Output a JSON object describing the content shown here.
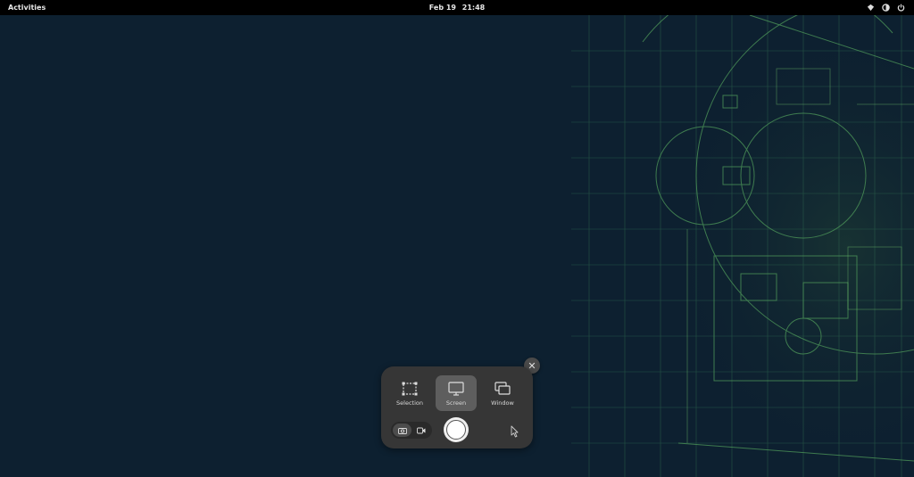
{
  "topbar": {
    "activities": "Activities",
    "date": "Feb 19",
    "time": "21:48",
    "tray_icons": [
      "network-icon",
      "volume-icon",
      "power-icon"
    ]
  },
  "screenshot_panel": {
    "modes": [
      {
        "label": "Selection",
        "icon": "selection-icon",
        "active": false
      },
      {
        "label": "Screen",
        "icon": "screen-icon",
        "active": true
      },
      {
        "label": "Window",
        "icon": "window-icon",
        "active": false
      }
    ],
    "toggle_options": [
      "screenshot-icon",
      "screencast-icon"
    ],
    "close_icon": "close-icon",
    "capture_icon": "capture-icon",
    "pointer_icon": "pointer-icon"
  },
  "colors": {
    "background": "#0d2030",
    "panel": "#363636",
    "active_mode": "#5e5e5e",
    "wallpaper_lines": "#3f8a55"
  }
}
